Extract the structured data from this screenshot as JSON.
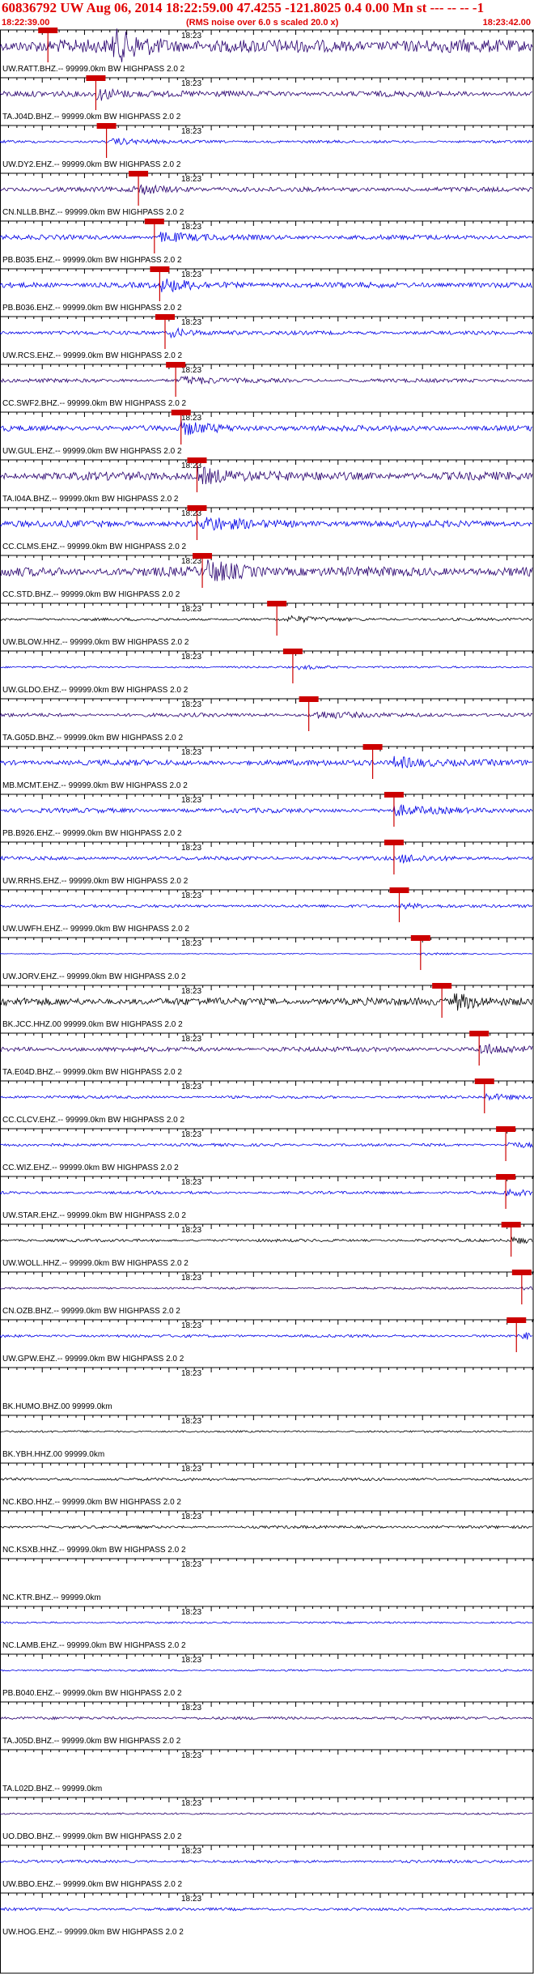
{
  "header": {
    "title": "60836792 UW Aug 06, 2014 18:22:59.00   47.4255 -121.8025  0.4 0.00 Mn st --- -- --  -1",
    "start_time": "18:22:39.00",
    "rms_note": "(RMS noise over 6.0 s scaled 20.0 x)",
    "end_time": "18:23:42.00"
  },
  "colors": {
    "header": "#e00000",
    "blue": "#0000e6",
    "purple": "#28006e",
    "black": "#000000",
    "pick": "#cc0000",
    "grid": "#000000"
  },
  "chart_data": {
    "type": "line",
    "x_range": [
      "18:22:39.00",
      "18:23:42.00"
    ],
    "minute_tick_label": "18:23",
    "traces": [
      {
        "station": "UW.RATT.BHZ.--",
        "label": "UW.RATT.BHZ.-- 99999.0km BW  HIGHPASS  2.0  2",
        "color": "purple",
        "amp": 14,
        "pick": 0.09,
        "event": 0.22
      },
      {
        "station": "TA.J04D.BHZ.--",
        "label": "TA.J04D.BHZ.-- 99999.0km BW  HIGHPASS  2.0  2",
        "color": "purple",
        "amp": 6,
        "pick": 0.18,
        "event": 0.19
      },
      {
        "station": "UW.DY2.EHZ.--",
        "label": "UW.DY2.EHZ.-- 99999.0km BW  HIGHPASS  2.0  2",
        "color": "blue",
        "amp": 3,
        "pick": 0.2,
        "event": 0.22
      },
      {
        "station": "CN.NLLB.BHZ.--",
        "label": "CN.NLLB.BHZ.-- 99999.0km BW  HIGHPASS  2.0  2",
        "color": "purple",
        "amp": 5,
        "pick": 0.26,
        "event": 0.26
      },
      {
        "station": "PB.B035.EHZ.--",
        "label": "PB.B035.EHZ.-- 99999.0km BW  HIGHPASS  2.0  2",
        "color": "blue",
        "amp": 5,
        "pick": 0.29,
        "event": 0.31
      },
      {
        "station": "PB.B036.EHZ.--",
        "label": "PB.B036.EHZ.-- 99999.0km BW  HIGHPASS  2.0  2",
        "color": "blue",
        "amp": 6,
        "pick": 0.3,
        "event": 0.31
      },
      {
        "station": "UW.RCS.EHZ.--",
        "label": "UW.RCS.EHZ.-- 99999.0km BW  HIGHPASS  2.0  2",
        "color": "blue",
        "amp": 4,
        "pick": 0.31,
        "event": 0.33
      },
      {
        "station": "CC.SWF2.BHZ.--",
        "label": "CC.SWF2.BHZ.-- 99999.0km BW  HIGHPASS  2.0  2",
        "color": "purple",
        "amp": 4,
        "pick": 0.33,
        "event": 0.35
      },
      {
        "station": "UW.GUL.EHZ.--",
        "label": "UW.GUL.EHZ.-- 99999.0km BW  HIGHPASS  2.0  2",
        "color": "blue",
        "amp": 6,
        "pick": 0.34,
        "event": 0.35
      },
      {
        "station": "TA.I04A.BHZ.--",
        "label": "TA.I04A.BHZ.-- 99999.0km BW  HIGHPASS  2.0  2",
        "color": "purple",
        "amp": 9,
        "pick": 0.37,
        "event": 0.38
      },
      {
        "station": "CC.CLMS.EHZ.--",
        "label": "CC.CLMS.EHZ.-- 99999.0km BW  HIGHPASS  2.0  2",
        "color": "blue",
        "amp": 7,
        "pick": 0.37,
        "event": 0.39
      },
      {
        "station": "CC.STD.BHZ.--",
        "label": "CC.STD.BHZ.-- 99999.0km BW  HIGHPASS  2.0  2",
        "color": "purple",
        "amp": 10,
        "pick": 0.38,
        "event": 0.4
      },
      {
        "station": "UW.BLOW.HHZ.--",
        "label": "UW.BLOW.HHZ.-- 99999.0km BW  HIGHPASS  2.0  2",
        "color": "black",
        "amp": 3,
        "pick": 0.52,
        "event": 0.55
      },
      {
        "station": "UW.GLDO.EHZ.--",
        "label": "UW.GLDO.EHZ.-- 99999.0km BW  HIGHPASS  2.0  2",
        "color": "blue",
        "amp": 2,
        "pick": 0.55,
        "event": 0.57
      },
      {
        "station": "TA.G05D.BHZ.--",
        "label": "TA.G05D.BHZ.-- 99999.0km BW  HIGHPASS  2.0  2",
        "color": "purple",
        "amp": 4,
        "pick": 0.58,
        "event": 0.6
      },
      {
        "station": "MB.MCMT.EHZ.--",
        "label": "MB.MCMT.EHZ.-- 99999.0km BW  HIGHPASS  2.0  2",
        "color": "blue",
        "amp": 6,
        "pick": 0.7,
        "event": 0.75
      },
      {
        "station": "PB.B926.EHZ.--",
        "label": "PB.B926.EHZ.-- 99999.0km BW  HIGHPASS  2.0  2",
        "color": "blue",
        "amp": 5,
        "pick": 0.74,
        "event": 0.75
      },
      {
        "station": "UW.RRHS.EHZ.--",
        "label": "UW.RRHS.EHZ.-- 99999.0km BW  HIGHPASS  2.0  2",
        "color": "blue",
        "amp": 4,
        "pick": 0.74,
        "event": 0.76
      },
      {
        "station": "UW.UWFH.EHZ.--",
        "label": "UW.UWFH.EHZ.-- 99999.0km BW  HIGHPASS  2.0  2",
        "color": "blue",
        "amp": 3,
        "pick": 0.75,
        "event": 0.76
      },
      {
        "station": "UW.JORV.EHZ.--",
        "label": "UW.JORV.EHZ.-- 99999.0km BW  HIGHPASS  2.0  2",
        "color": "blue",
        "amp": 1,
        "pick": 0.79,
        "event": 0.8
      },
      {
        "station": "BK.JCC.HHZ.00",
        "label": "BK.JCC.HHZ.00 99999.0km BW  HIGHPASS  2.0  2",
        "color": "black",
        "amp": 8,
        "pick": 0.83,
        "event": 0.86
      },
      {
        "station": "TA.E04D.BHZ.--",
        "label": "TA.E04D.BHZ.-- 99999.0km BW  HIGHPASS  2.0  2",
        "color": "purple",
        "amp": 5,
        "pick": 0.9,
        "event": 0.91
      },
      {
        "station": "CC.CLCV.EHZ.--",
        "label": "CC.CLCV.EHZ.-- 99999.0km BW  HIGHPASS  2.0  2",
        "color": "blue",
        "amp": 3,
        "pick": 0.91,
        "event": 0.92
      },
      {
        "station": "CC.WIZ.EHZ.--",
        "label": "CC.WIZ.EHZ.-- 99999.0km BW  HIGHPASS  2.0  2",
        "color": "blue",
        "amp": 3,
        "pick": 0.95,
        "event": 0.96
      },
      {
        "station": "UW.STAR.EHZ.--",
        "label": "UW.STAR.EHZ.-- 99999.0km BW  HIGHPASS  2.0  2",
        "color": "blue",
        "amp": 3,
        "pick": 0.95,
        "event": 0.96
      },
      {
        "station": "UW.WOLL.HHZ.--",
        "label": "UW.WOLL.HHZ.-- 99999.0km BW  HIGHPASS  2.0  2",
        "color": "black",
        "amp": 3,
        "pick": 0.96,
        "event": 0.97
      },
      {
        "station": "CN.OZB.BHZ.--",
        "label": "CN.OZB.BHZ.-- 99999.0km BW  HIGHPASS  2.0  2",
        "color": "purple",
        "amp": 2,
        "pick": 0.98,
        "event": 0.99
      },
      {
        "station": "UW.GPW.EHZ.--",
        "label": "UW.GPW.EHZ.-- 99999.0km BW  HIGHPASS  2.0  2",
        "color": "blue",
        "amp": 3,
        "pick": 0.97,
        "event": 0.99
      },
      {
        "station": "BK.HUMO.BHZ.00",
        "label": "BK.HUMO.BHZ.00 99999.0km",
        "color": "none",
        "amp": 0,
        "pick": null,
        "event": null
      },
      {
        "station": "BK.YBH.HHZ.00",
        "label": "BK.YBH.HHZ.00 99999.0km",
        "color": "black",
        "amp": 2,
        "pick": null,
        "event": null
      },
      {
        "station": "NC.KBO.HHZ.--",
        "label": "NC.KBO.HHZ.-- 99999.0km BW  HIGHPASS  2.0  2",
        "color": "black",
        "amp": 3,
        "pick": null,
        "event": null
      },
      {
        "station": "NC.KSXB.HHZ.--",
        "label": "NC.KSXB.HHZ.-- 99999.0km BW  HIGHPASS  2.0  2",
        "color": "black",
        "amp": 3,
        "pick": null,
        "event": null
      },
      {
        "station": "NC.KTR.BHZ.--",
        "label": "NC.KTR.BHZ.-- 99999.0km",
        "color": "none",
        "amp": 0,
        "pick": null,
        "event": null
      },
      {
        "station": "NC.LAMB.EHZ.--",
        "label": "NC.LAMB.EHZ.-- 99999.0km BW  HIGHPASS  2.0  2",
        "color": "blue",
        "amp": 2,
        "pick": null,
        "event": null
      },
      {
        "station": "PB.B040.EHZ.--",
        "label": "PB.B040.EHZ.-- 99999.0km BW  HIGHPASS  2.0  2",
        "color": "blue",
        "amp": 2,
        "pick": null,
        "event": null
      },
      {
        "station": "TA.J05D.BHZ.--",
        "label": "TA.J05D.BHZ.-- 99999.0km BW  HIGHPASS  2.0  2",
        "color": "purple",
        "amp": 3,
        "pick": null,
        "event": null
      },
      {
        "station": "TA.L02D.BHZ.--",
        "label": "TA.L02D.BHZ.-- 99999.0km",
        "color": "none",
        "amp": 0,
        "pick": null,
        "event": null
      },
      {
        "station": "UO.DBO.BHZ.--",
        "label": "UO.DBO.BHZ.-- 99999.0km BW  HIGHPASS  2.0  2",
        "color": "purple",
        "amp": 2,
        "pick": null,
        "event": null
      },
      {
        "station": "UW.BBO.EHZ.--",
        "label": "UW.BBO.EHZ.-- 99999.0km BW  HIGHPASS  2.0  2",
        "color": "blue",
        "amp": 3,
        "pick": null,
        "event": null
      },
      {
        "station": "UW.HOG.EHZ.--",
        "label": "UW.HOG.EHZ.-- 99999.0km BW  HIGHPASS  2.0  2",
        "color": "blue",
        "amp": 3,
        "pick": null,
        "event": null
      }
    ]
  }
}
